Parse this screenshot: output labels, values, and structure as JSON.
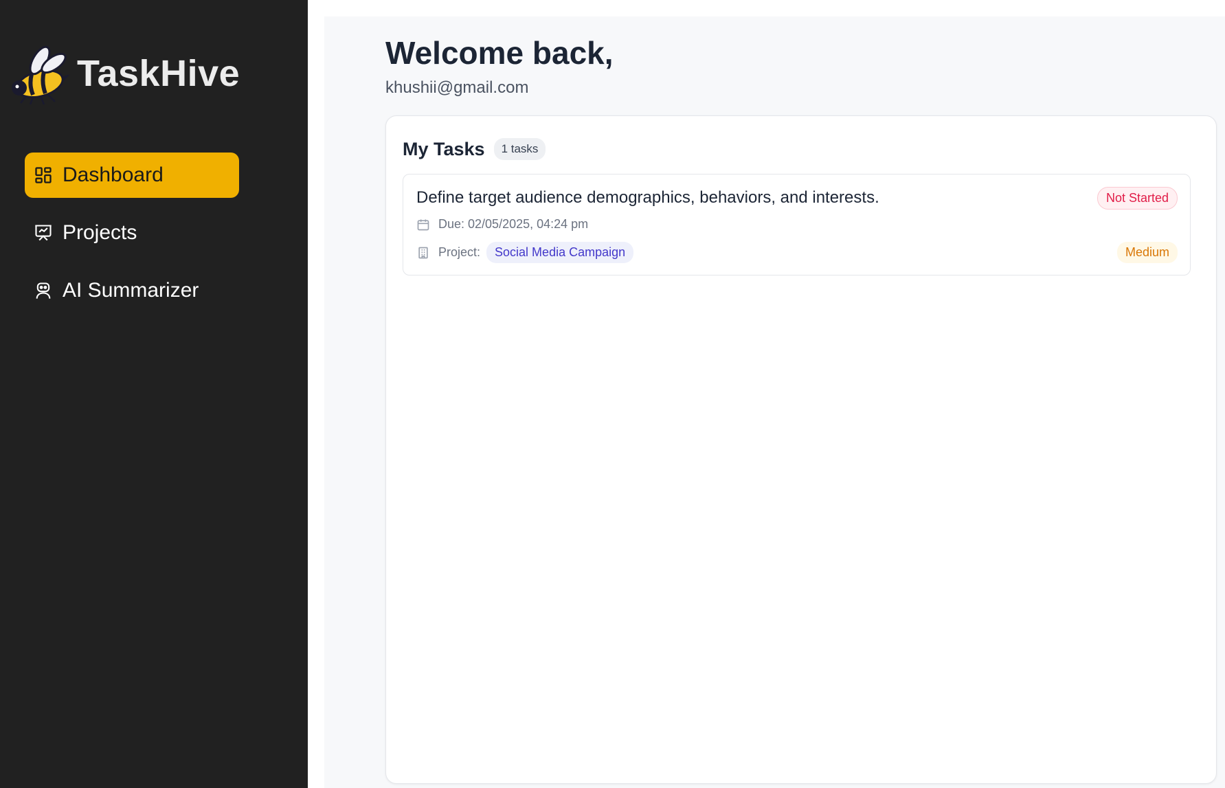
{
  "app": {
    "name": "TaskHive",
    "logo_icon": "bee-icon"
  },
  "sidebar": {
    "items": [
      {
        "label": "Dashboard",
        "icon": "dashboard-grid-icon",
        "active": true
      },
      {
        "label": "Projects",
        "icon": "presentation-chart-icon",
        "active": false
      },
      {
        "label": "AI Summarizer",
        "icon": "robot-icon",
        "active": false
      }
    ]
  },
  "header": {
    "greeting": "Welcome back,",
    "email": "khushii@gmail.com"
  },
  "tasks_panel": {
    "title": "My Tasks",
    "count_label": "1 tasks",
    "tasks": [
      {
        "title": "Define target audience demographics, behaviors, and interests.",
        "status": "Not Started",
        "due": "Due: 02/05/2025, 04:24 pm",
        "project_label": "Project:",
        "project": "Social Media Campaign",
        "priority": "Medium"
      }
    ]
  },
  "colors": {
    "sidebar_bg": "#212121",
    "accent": "#f0b000",
    "status_not_started": "#e11d48",
    "project_tag": "#4338ca",
    "priority_medium": "#d97706"
  }
}
